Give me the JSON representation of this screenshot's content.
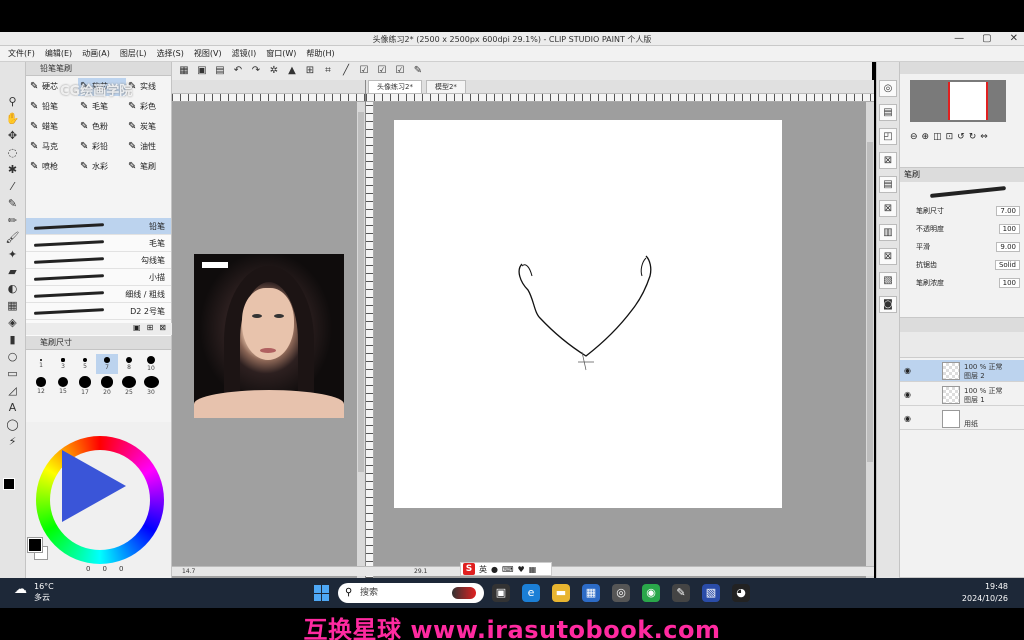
{
  "window": {
    "title": "头像练习2* (2500 x 2500px 600dpi 29.1%)  - CLIP STUDIO PAINT 个人版",
    "close": "✕",
    "minimize": "—",
    "maximize": "▢"
  },
  "menu": [
    "文件(F)",
    "编辑(E)",
    "动画(A)",
    "图层(L)",
    "选择(S)",
    "视图(V)",
    "滤镜(I)",
    "窗口(W)",
    "帮助(H)"
  ],
  "watermark": "CG绘画学院",
  "subtool": {
    "header": "铅笔笔刷",
    "items": [
      "硬芯",
      "软芯",
      "实线",
      "铅笔",
      "毛笔",
      "彩色",
      "蜡笔",
      "色粉",
      "炭笔",
      "马克",
      "彩铅",
      "油性",
      "喷枪",
      "水彩",
      "笔刷"
    ],
    "selected_index": 1
  },
  "brushes": [
    {
      "label": "铅笔"
    },
    {
      "label": "毛笔"
    },
    {
      "label": "勾线笔"
    },
    {
      "label": "小描"
    },
    {
      "label": "细线 / 粗线"
    },
    {
      "label": "D2 2号笔"
    }
  ],
  "brush_selected_index": 0,
  "brush_sizes": {
    "header": "笔刷尺寸",
    "values": [
      "1",
      "3",
      "5",
      "7",
      "8",
      "10",
      "12",
      "15",
      "17",
      "20",
      "25",
      "30"
    ],
    "selected_index": 3
  },
  "color_values": [
    "0",
    "0",
    "0"
  ],
  "canvas": {
    "tabs": [
      "头像练习2*",
      "模型2*"
    ],
    "active_tab": 0,
    "zoom_left": "29.1",
    "zoom_ref": "14.7"
  },
  "ime": {
    "badge": "S",
    "text": "英"
  },
  "tool_property": {
    "header": "笔刷",
    "rows": [
      {
        "label": "笔刷尺寸",
        "value": "7.00"
      },
      {
        "label": "不透明度",
        "value": "100"
      },
      {
        "label": "平滑",
        "value": "9.00"
      },
      {
        "label": "抗锯齿",
        "value": "Solid"
      },
      {
        "label": "笔刷浓度",
        "value": "100"
      }
    ]
  },
  "layers": [
    {
      "name": "100 % 正常",
      "sub": "图层 2",
      "selected": true
    },
    {
      "name": "100 % 正常",
      "sub": "图层 1",
      "selected": false
    },
    {
      "name": "",
      "sub": "用纸",
      "selected": false
    }
  ],
  "taskbar": {
    "temp": "16°C",
    "weather": "多云",
    "search": "搜索",
    "time": "19:48",
    "date": "2024/10/26"
  },
  "banner": "互换星球 www.irasutobook.com",
  "colors": {
    "accent": "#bcd3ee",
    "banner": "#ff2aa0",
    "taskbar": "#1d2838"
  }
}
